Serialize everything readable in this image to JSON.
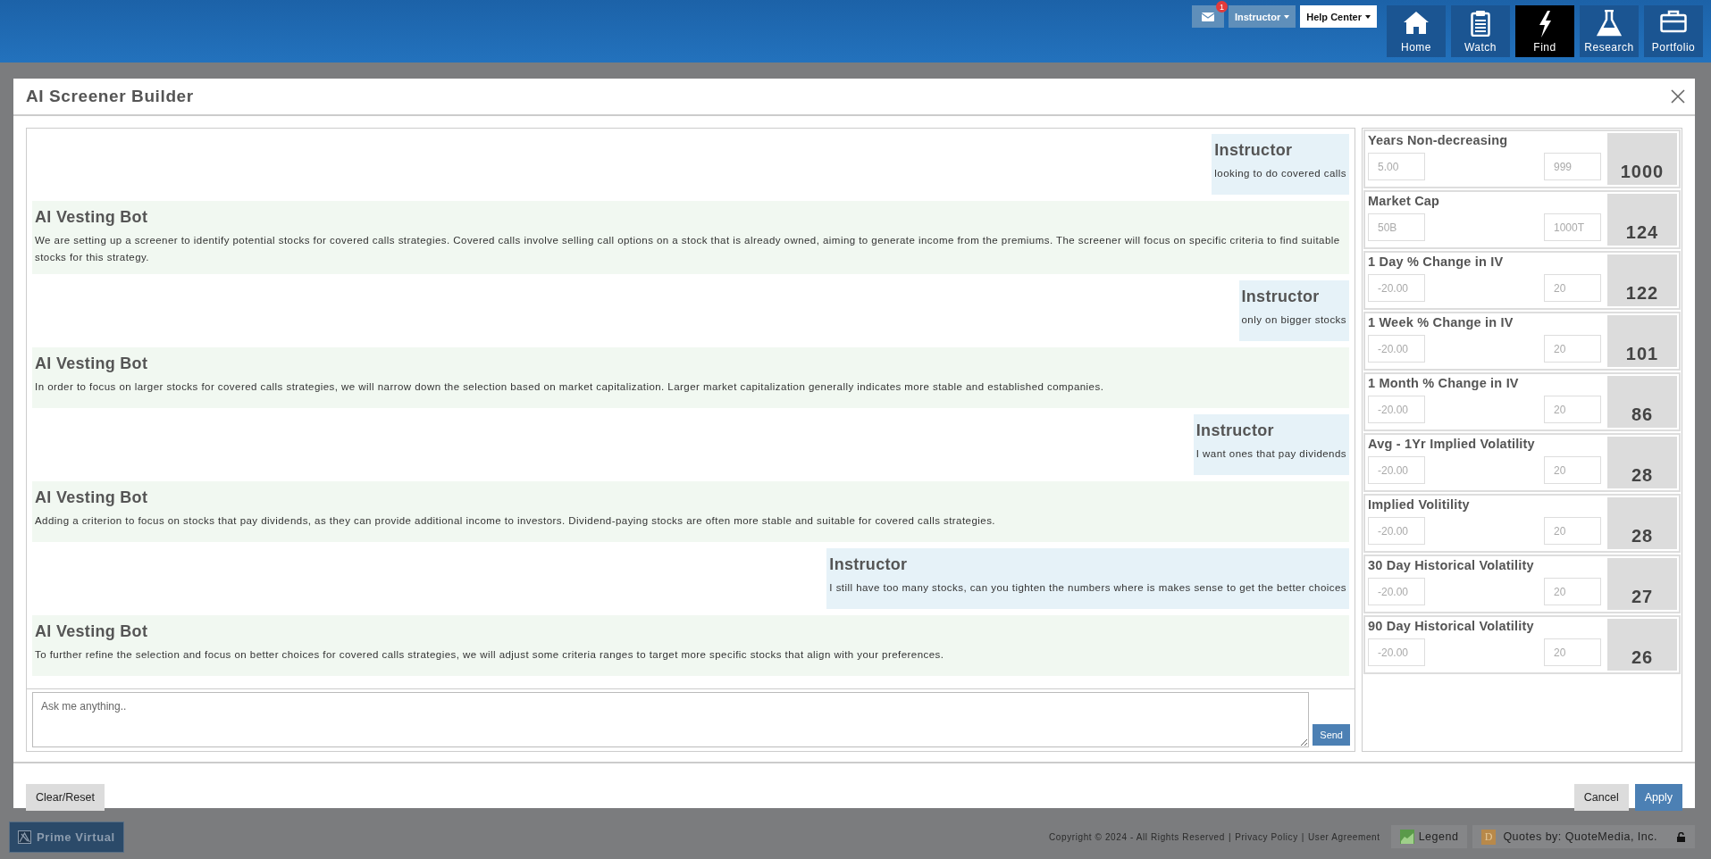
{
  "topbar": {
    "mail": {
      "badge": "1"
    },
    "user_menu": "Instructor",
    "help_menu": "Help Center",
    "nav": [
      {
        "label": "Home",
        "kind": "home",
        "selected": false
      },
      {
        "label": "Watch",
        "kind": "watch",
        "selected": false
      },
      {
        "label": "Find",
        "kind": "find",
        "selected": true
      },
      {
        "label": "Research",
        "kind": "research",
        "selected": false
      },
      {
        "label": "Portfolio",
        "kind": "portfolio",
        "selected": false
      }
    ]
  },
  "modal": {
    "title": "AI Screener Builder",
    "messages": [
      {
        "kind": "user",
        "author": "Instructor",
        "text": "looking to do covered calls"
      },
      {
        "kind": "bot",
        "author": "AI Vesting Bot",
        "text": "We are setting up a screener to identify potential stocks for covered calls strategies. Covered calls involve selling call options on a stock that is already owned, aiming to generate income from the premiums. The screener will focus on specific criteria to find suitable stocks for this strategy."
      },
      {
        "kind": "user",
        "author": "Instructor",
        "text": "only on bigger stocks"
      },
      {
        "kind": "bot",
        "author": "AI Vesting Bot",
        "text": "In order to focus on larger stocks for covered calls strategies, we will narrow down the selection based on market capitalization. Larger market capitalization generally indicates more stable and established companies."
      },
      {
        "kind": "user",
        "author": "Instructor",
        "text": "I want ones that pay dividends"
      },
      {
        "kind": "bot",
        "author": "AI Vesting Bot",
        "text": "Adding a criterion to focus on stocks that pay dividends, as they can provide additional income to investors. Dividend-paying stocks are often more stable and suitable for covered calls strategies."
      },
      {
        "kind": "user",
        "author": "Instructor",
        "text": "I still have too many stocks, can you tighten the numbers where is makes sense to get the better choices"
      },
      {
        "kind": "bot",
        "author": "AI Vesting Bot",
        "text": "To further refine the selection and focus on better choices for covered calls strategies, we will adjust some criteria ranges to target more specific stocks that align with your preferences."
      }
    ],
    "input": {
      "placeholder": "Ask me anything.."
    },
    "send": "Send",
    "criteria": [
      {
        "name": "Years Non-decreasing",
        "min": {
          "placeholder": "5.00"
        },
        "max": {
          "placeholder": "999"
        },
        "count": "1000"
      },
      {
        "name": "Market Cap",
        "min": {
          "placeholder": "50B"
        },
        "max": {
          "placeholder": "1000T"
        },
        "count": "124"
      },
      {
        "name": "1 Day % Change in IV",
        "min": {
          "placeholder": "-20.00"
        },
        "max": {
          "placeholder": "20"
        },
        "count": "122"
      },
      {
        "name": "1 Week % Change in IV",
        "min": {
          "placeholder": "-20.00"
        },
        "max": {
          "placeholder": "20"
        },
        "count": "101"
      },
      {
        "name": "1 Month % Change in IV",
        "min": {
          "placeholder": "-20.00"
        },
        "max": {
          "placeholder": "20"
        },
        "count": "86"
      },
      {
        "name": "Avg - 1Yr Implied Volatility",
        "min": {
          "placeholder": "-20.00"
        },
        "max": {
          "placeholder": "20"
        },
        "count": "28"
      },
      {
        "name": "Implied Volitility",
        "min": {
          "placeholder": "-20.00"
        },
        "max": {
          "placeholder": "20"
        },
        "count": "28"
      },
      {
        "name": "30 Day Historical Volatility",
        "min": {
          "placeholder": "-20.00"
        },
        "max": {
          "placeholder": "20"
        },
        "count": "27"
      },
      {
        "name": "90 Day Historical Volatility",
        "min": {
          "placeholder": "-20.00"
        },
        "max": {
          "placeholder": "20"
        },
        "count": "26"
      }
    ],
    "clear": "Clear/Reset",
    "cancel": "Cancel",
    "apply": "Apply"
  },
  "footer": {
    "app_button": "Prime Virtual",
    "copyright": "Copyright © 2024 - All Rights Reserved",
    "separator_1": "|",
    "privacy": "Privacy Policy",
    "separator_2": "|",
    "agreement": "User Agreement",
    "legend": "Legend",
    "quotes_logo": "D",
    "quotes": "Quotes by: QuoteMedia, Inc."
  }
}
